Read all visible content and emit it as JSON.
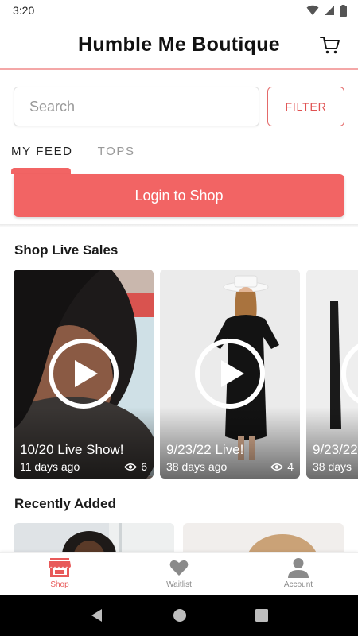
{
  "status": {
    "time": "3:20"
  },
  "header": {
    "title": "Humble Me Boutique"
  },
  "search": {
    "placeholder": "Search",
    "value": ""
  },
  "filter": {
    "label": "FILTER"
  },
  "tabs": [
    {
      "label": "MY FEED",
      "active": true
    },
    {
      "label": "TOPS",
      "active": false
    }
  ],
  "login": {
    "label": "Login to Shop"
  },
  "live_sales": {
    "title": "Shop Live Sales",
    "cards": [
      {
        "title": "10/20 Live Show!",
        "age": "11 days ago",
        "views": "6"
      },
      {
        "title": "9/23/22 Live!",
        "age": "38 days ago",
        "views": "4"
      },
      {
        "title": "9/23/22",
        "age": "38 days"
      }
    ]
  },
  "recently_added": {
    "title": "Recently Added"
  },
  "bottom_nav": [
    {
      "label": "Shop",
      "icon": "store-icon",
      "active": true
    },
    {
      "label": "Waitlist",
      "icon": "heart-icon",
      "active": false
    },
    {
      "label": "Account",
      "icon": "person-icon",
      "active": false
    }
  ],
  "colors": {
    "accent": "#f26464",
    "nav_active": "#e85a5a"
  }
}
